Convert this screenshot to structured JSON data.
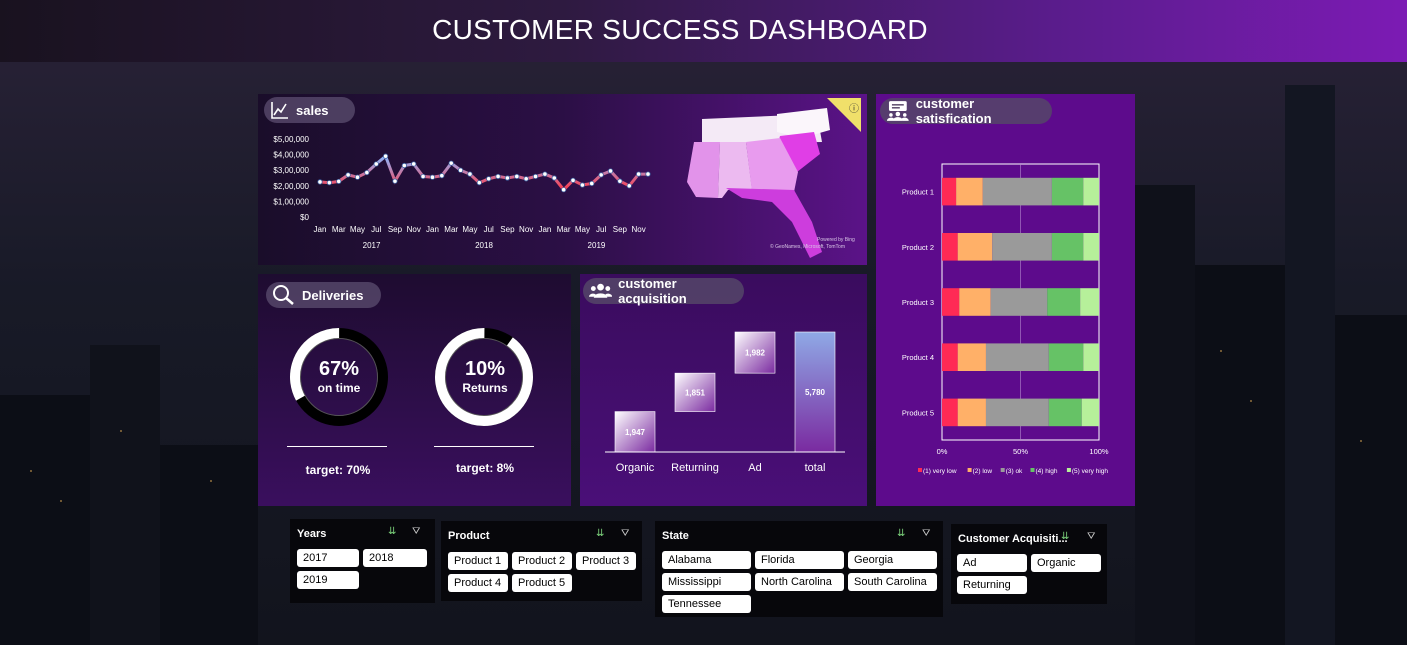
{
  "title": "CUSTOMER SUCCESS DASHBOARD",
  "sales": {
    "label": "sales",
    "map_credit_1": "Powered by Bing",
    "map_credit_2": "© GeoNames, Microsoft, TomTom",
    "chart_data": {
      "type": "line",
      "ylabels": [
        "$5,00,000",
        "$4,00,000",
        "$3,00,000",
        "$2,00,000",
        "$1,00,000",
        "$0"
      ],
      "ylim": [
        0,
        500000
      ],
      "month_labels": [
        "Jan",
        "Mar",
        "May",
        "Jul",
        "Sep",
        "Nov",
        "Jan",
        "Mar",
        "May",
        "Jul",
        "Sep",
        "Nov",
        "Jan",
        "Mar",
        "May",
        "Jul",
        "Sep",
        "Nov"
      ],
      "years": [
        "2017",
        "2018",
        "2019"
      ],
      "values": [
        225000,
        220000,
        228000,
        270000,
        255000,
        285000,
        340000,
        390000,
        230000,
        330000,
        340000,
        260000,
        255000,
        265000,
        345000,
        300000,
        275000,
        220000,
        245000,
        260000,
        250000,
        260000,
        245000,
        260000,
        275000,
        250000,
        175000,
        235000,
        205000,
        215000,
        270000,
        295000,
        230000,
        200000,
        275000,
        275000
      ]
    }
  },
  "deliveries": {
    "label": "Deliveries",
    "ontime": {
      "value": "67%",
      "label": "on time",
      "fraction": 0.67,
      "target": "target: 70%"
    },
    "returns": {
      "value": "10%",
      "label": "Returns",
      "fraction": 0.1,
      "target": "target: 8%"
    }
  },
  "acquisition": {
    "label": "customer acquisition",
    "chart_data": {
      "type": "bar",
      "subtype": "waterfall",
      "categories": [
        "Organic",
        "Returning",
        "Ad",
        "total"
      ],
      "values": [
        1947,
        1851,
        1982,
        5780
      ],
      "value_labels": [
        "1,947",
        "1,851",
        "1,982",
        "5,780"
      ]
    }
  },
  "satisfaction": {
    "label": "customer satisfication",
    "chart_data": {
      "type": "bar",
      "subtype": "100%-stacked-horizontal",
      "categories": [
        "Product 1",
        "Product 2",
        "Product 3",
        "Product 4",
        "Product 5"
      ],
      "series": [
        {
          "name": "(1) very low",
          "color": "#ff2a55",
          "values": [
            0.09,
            0.1,
            0.11,
            0.1,
            0.1
          ]
        },
        {
          "name": "(2) low",
          "color": "#ffb068",
          "values": [
            0.17,
            0.22,
            0.2,
            0.18,
            0.18
          ]
        },
        {
          "name": "(3) ok",
          "color": "#9a9a9a",
          "values": [
            0.44,
            0.38,
            0.36,
            0.4,
            0.4
          ]
        },
        {
          "name": "(4) high",
          "color": "#66c266",
          "values": [
            0.2,
            0.2,
            0.21,
            0.22,
            0.21
          ]
        },
        {
          "name": "(5) very high",
          "color": "#b6f09a",
          "values": [
            0.1,
            0.1,
            0.12,
            0.1,
            0.11
          ]
        }
      ],
      "xticks": [
        "0%",
        "50%",
        "100%"
      ],
      "legend_position": "bottom"
    }
  },
  "slicers": {
    "years": {
      "header": "Years",
      "items": [
        "2017",
        "2018",
        "2019"
      ]
    },
    "product": {
      "header": "Product",
      "items": [
        "Product 1",
        "Product 2",
        "Product 3",
        "Product 4",
        "Product 5"
      ]
    },
    "state": {
      "header": "State",
      "items": [
        "Alabama",
        "Florida",
        "Georgia",
        "Mississippi",
        "North Carolina",
        "South Carolina",
        "Tennessee"
      ]
    },
    "acquisition": {
      "header": "Customer Acquisiti...",
      "items": [
        "Ad",
        "Organic",
        "Returning"
      ]
    }
  }
}
